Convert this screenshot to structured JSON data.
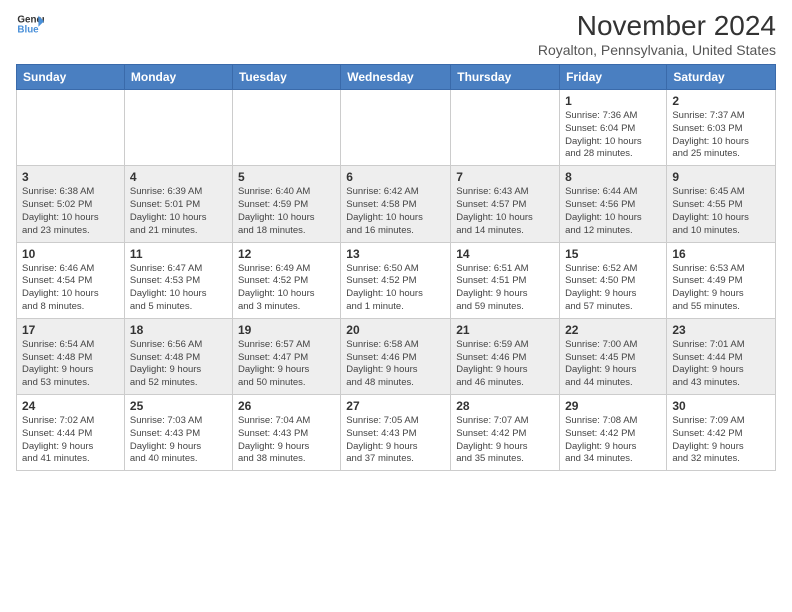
{
  "logo": {
    "line1": "General",
    "line2": "Blue",
    "icon": "🔷"
  },
  "title": "November 2024",
  "location": "Royalton, Pennsylvania, United States",
  "days_of_week": [
    "Sunday",
    "Monday",
    "Tuesday",
    "Wednesday",
    "Thursday",
    "Friday",
    "Saturday"
  ],
  "weeks": [
    [
      {
        "num": "",
        "info": ""
      },
      {
        "num": "",
        "info": ""
      },
      {
        "num": "",
        "info": ""
      },
      {
        "num": "",
        "info": ""
      },
      {
        "num": "",
        "info": ""
      },
      {
        "num": "1",
        "info": "Sunrise: 7:36 AM\nSunset: 6:04 PM\nDaylight: 10 hours\nand 28 minutes."
      },
      {
        "num": "2",
        "info": "Sunrise: 7:37 AM\nSunset: 6:03 PM\nDaylight: 10 hours\nand 25 minutes."
      }
    ],
    [
      {
        "num": "3",
        "info": "Sunrise: 6:38 AM\nSunset: 5:02 PM\nDaylight: 10 hours\nand 23 minutes."
      },
      {
        "num": "4",
        "info": "Sunrise: 6:39 AM\nSunset: 5:01 PM\nDaylight: 10 hours\nand 21 minutes."
      },
      {
        "num": "5",
        "info": "Sunrise: 6:40 AM\nSunset: 4:59 PM\nDaylight: 10 hours\nand 18 minutes."
      },
      {
        "num": "6",
        "info": "Sunrise: 6:42 AM\nSunset: 4:58 PM\nDaylight: 10 hours\nand 16 minutes."
      },
      {
        "num": "7",
        "info": "Sunrise: 6:43 AM\nSunset: 4:57 PM\nDaylight: 10 hours\nand 14 minutes."
      },
      {
        "num": "8",
        "info": "Sunrise: 6:44 AM\nSunset: 4:56 PM\nDaylight: 10 hours\nand 12 minutes."
      },
      {
        "num": "9",
        "info": "Sunrise: 6:45 AM\nSunset: 4:55 PM\nDaylight: 10 hours\nand 10 minutes."
      }
    ],
    [
      {
        "num": "10",
        "info": "Sunrise: 6:46 AM\nSunset: 4:54 PM\nDaylight: 10 hours\nand 8 minutes."
      },
      {
        "num": "11",
        "info": "Sunrise: 6:47 AM\nSunset: 4:53 PM\nDaylight: 10 hours\nand 5 minutes."
      },
      {
        "num": "12",
        "info": "Sunrise: 6:49 AM\nSunset: 4:52 PM\nDaylight: 10 hours\nand 3 minutes."
      },
      {
        "num": "13",
        "info": "Sunrise: 6:50 AM\nSunset: 4:52 PM\nDaylight: 10 hours\nand 1 minute."
      },
      {
        "num": "14",
        "info": "Sunrise: 6:51 AM\nSunset: 4:51 PM\nDaylight: 9 hours\nand 59 minutes."
      },
      {
        "num": "15",
        "info": "Sunrise: 6:52 AM\nSunset: 4:50 PM\nDaylight: 9 hours\nand 57 minutes."
      },
      {
        "num": "16",
        "info": "Sunrise: 6:53 AM\nSunset: 4:49 PM\nDaylight: 9 hours\nand 55 minutes."
      }
    ],
    [
      {
        "num": "17",
        "info": "Sunrise: 6:54 AM\nSunset: 4:48 PM\nDaylight: 9 hours\nand 53 minutes."
      },
      {
        "num": "18",
        "info": "Sunrise: 6:56 AM\nSunset: 4:48 PM\nDaylight: 9 hours\nand 52 minutes."
      },
      {
        "num": "19",
        "info": "Sunrise: 6:57 AM\nSunset: 4:47 PM\nDaylight: 9 hours\nand 50 minutes."
      },
      {
        "num": "20",
        "info": "Sunrise: 6:58 AM\nSunset: 4:46 PM\nDaylight: 9 hours\nand 48 minutes."
      },
      {
        "num": "21",
        "info": "Sunrise: 6:59 AM\nSunset: 4:46 PM\nDaylight: 9 hours\nand 46 minutes."
      },
      {
        "num": "22",
        "info": "Sunrise: 7:00 AM\nSunset: 4:45 PM\nDaylight: 9 hours\nand 44 minutes."
      },
      {
        "num": "23",
        "info": "Sunrise: 7:01 AM\nSunset: 4:44 PM\nDaylight: 9 hours\nand 43 minutes."
      }
    ],
    [
      {
        "num": "24",
        "info": "Sunrise: 7:02 AM\nSunset: 4:44 PM\nDaylight: 9 hours\nand 41 minutes."
      },
      {
        "num": "25",
        "info": "Sunrise: 7:03 AM\nSunset: 4:43 PM\nDaylight: 9 hours\nand 40 minutes."
      },
      {
        "num": "26",
        "info": "Sunrise: 7:04 AM\nSunset: 4:43 PM\nDaylight: 9 hours\nand 38 minutes."
      },
      {
        "num": "27",
        "info": "Sunrise: 7:05 AM\nSunset: 4:43 PM\nDaylight: 9 hours\nand 37 minutes."
      },
      {
        "num": "28",
        "info": "Sunrise: 7:07 AM\nSunset: 4:42 PM\nDaylight: 9 hours\nand 35 minutes."
      },
      {
        "num": "29",
        "info": "Sunrise: 7:08 AM\nSunset: 4:42 PM\nDaylight: 9 hours\nand 34 minutes."
      },
      {
        "num": "30",
        "info": "Sunrise: 7:09 AM\nSunset: 4:42 PM\nDaylight: 9 hours\nand 32 minutes."
      }
    ]
  ]
}
